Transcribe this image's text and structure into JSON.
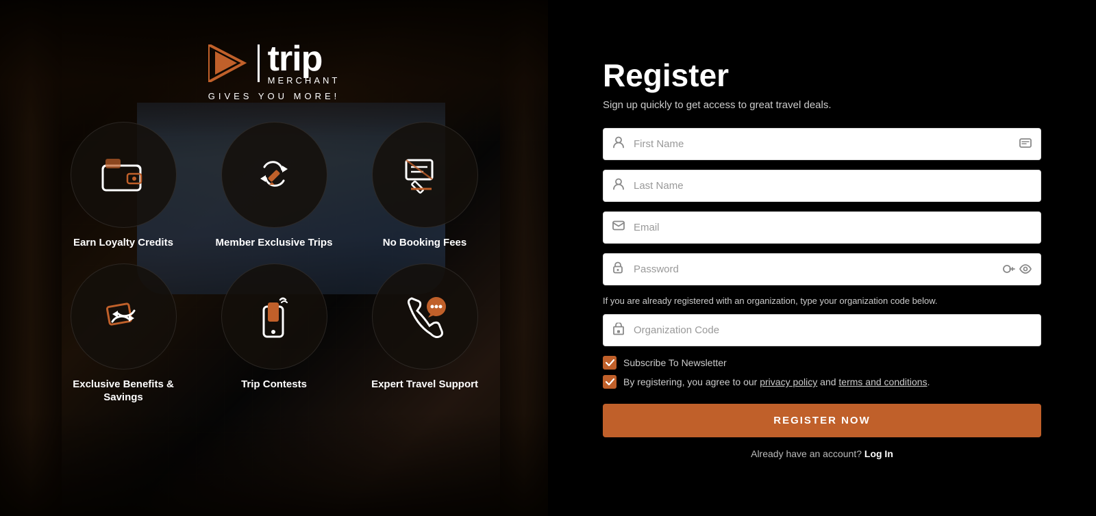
{
  "left": {
    "logo": {
      "trip": "trip",
      "merchant": "MERCHANT",
      "tagline": "GIVES YOU MORE!"
    },
    "features": [
      {
        "id": "earn-loyalty",
        "label": "Earn Loyalty Credits",
        "icon": "wallet"
      },
      {
        "id": "member-exclusive",
        "label": "Member Exclusive Trips",
        "icon": "arrows-exchange"
      },
      {
        "id": "no-booking",
        "label": "No Booking Fees",
        "icon": "tag-pencil"
      },
      {
        "id": "exclusive-benefits",
        "label": "Exclusive Benefits & Savings",
        "icon": "tag-arrows"
      },
      {
        "id": "trip-contests",
        "label": "Trip Contests",
        "icon": "phone-signal"
      },
      {
        "id": "expert-support",
        "label": "Expert Travel Support",
        "icon": "phone-chat"
      }
    ]
  },
  "right": {
    "title": "Register",
    "subtitle": "Sign up quickly to get access to great travel deals.",
    "fields": {
      "first_name": {
        "placeholder": "First Name"
      },
      "last_name": {
        "placeholder": "Last Name"
      },
      "email": {
        "placeholder": "Email"
      },
      "password": {
        "placeholder": "Password"
      },
      "org_code": {
        "placeholder": "Organization Code"
      }
    },
    "org_hint": "If you are already registered with an organization, type your organization code below.",
    "checkbox_newsletter": "Subscribe To Newsletter",
    "checkbox_terms_prefix": "By registering, you agree to our ",
    "checkbox_privacy": "privacy policy",
    "checkbox_and": " and ",
    "checkbox_terms": "terms and conditions",
    "checkbox_terms_suffix": ".",
    "register_button": "REGISTER NOW",
    "login_prompt": "Already have an account?",
    "login_link": "Log In"
  }
}
